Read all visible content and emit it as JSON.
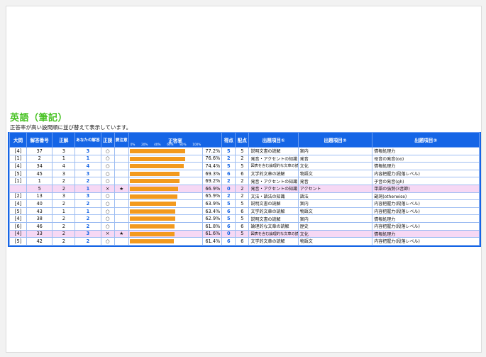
{
  "title": "英語（筆記）",
  "note": "正答率が高い設問順に並び替えて表示しています。",
  "colors": {
    "header_bg": "#1565e6",
    "bar": "#f39a1e",
    "title": "#44c11f",
    "highlight_row": "#f6d8f4"
  },
  "headers": {
    "daimon": "大問",
    "kaitou_bangou": "解答番号",
    "seikai": "正解",
    "anata": "あなたの解答",
    "seigo": "正誤",
    "chui": "要注意",
    "rate": "正答率",
    "tokuten": "得点",
    "haiten": "配点",
    "item1": "出題項目①",
    "item2": "出題項目②",
    "item3": "出題項目③"
  },
  "rate_ticks": [
    "0%",
    "20%",
    "40%",
    "60%",
    "80%",
    "100%"
  ],
  "rows": [
    {
      "daimon": "[4]",
      "num": "37",
      "correct": "3",
      "answer": "3",
      "judge": "○",
      "flag": "",
      "rate": 77.2,
      "rate_label": "77.2%",
      "score": "5",
      "points": "5",
      "item1": "説明文書の読解",
      "item2": "案内",
      "item3": "情報処理力",
      "highlight": false
    },
    {
      "daimon": "[1]",
      "num": "2",
      "correct": "1",
      "answer": "1",
      "judge": "○",
      "flag": "",
      "rate": 76.6,
      "rate_label": "76.6%",
      "score": "2",
      "points": "2",
      "item1": "発音・アクセントの知識",
      "item2": "発音",
      "item3": "母音の発音(oo)",
      "highlight": false
    },
    {
      "daimon": "[4]",
      "num": "34",
      "correct": "4",
      "answer": "4",
      "judge": "○",
      "flag": "",
      "rate": 74.4,
      "rate_label": "74.4%",
      "score": "5",
      "points": "5",
      "item1": "図表を含む論理的な文章の読解",
      "item2": "文化",
      "item3": "情報処理力",
      "highlight": false
    },
    {
      "daimon": "[5]",
      "num": "45",
      "correct": "3",
      "answer": "3",
      "judge": "○",
      "flag": "",
      "rate": 69.3,
      "rate_label": "69.3%",
      "score": "6",
      "points": "6",
      "item1": "文学的文章の読解",
      "item2": "物語文",
      "item3": "内容把握力(段落レベル)",
      "highlight": false
    },
    {
      "daimon": "[1]",
      "num": "1",
      "correct": "2",
      "answer": "2",
      "judge": "○",
      "flag": "",
      "rate": 69.2,
      "rate_label": "69.2%",
      "score": "2",
      "points": "2",
      "item1": "発音・アクセントの知識",
      "item2": "発音",
      "item3": "子音の発音(gh)",
      "highlight": false
    },
    {
      "daimon": "",
      "num": "5",
      "correct": "2",
      "answer": "1",
      "judge": "×",
      "flag": "★",
      "rate": 66.9,
      "rate_label": "66.9%",
      "score": "0",
      "points": "2",
      "item1": "発音・アクセントの知識",
      "item2": "アクセント",
      "item3": "単語の強勢(3音節)",
      "highlight": true
    },
    {
      "daimon": "[2]",
      "num": "13",
      "correct": "3",
      "answer": "3",
      "judge": "○",
      "flag": "",
      "rate": 65.9,
      "rate_label": "65.9%",
      "score": "2",
      "points": "2",
      "item1": "文法・語法の知識",
      "item2": "語法",
      "item3": "副詞(otherwise)",
      "highlight": false
    },
    {
      "daimon": "[4]",
      "num": "40",
      "correct": "2",
      "answer": "2",
      "judge": "○",
      "flag": "",
      "rate": 63.9,
      "rate_label": "63.9%",
      "score": "5",
      "points": "5",
      "item1": "説明文書の読解",
      "item2": "案内",
      "item3": "内容把握力(段落レベル)",
      "highlight": false
    },
    {
      "daimon": "[5]",
      "num": "43",
      "correct": "1",
      "answer": "1",
      "judge": "○",
      "flag": "",
      "rate": 63.4,
      "rate_label": "63.4%",
      "score": "6",
      "points": "6",
      "item1": "文学的文章の読解",
      "item2": "物語文",
      "item3": "内容把握力(段落レベル)",
      "highlight": false
    },
    {
      "daimon": "[4]",
      "num": "38",
      "correct": "2",
      "answer": "2",
      "judge": "○",
      "flag": "",
      "rate": 62.9,
      "rate_label": "62.9%",
      "score": "5",
      "points": "5",
      "item1": "説明文書の読解",
      "item2": "案内",
      "item3": "情報処理力",
      "highlight": false
    },
    {
      "daimon": "[6]",
      "num": "46",
      "correct": "2",
      "answer": "2",
      "judge": "○",
      "flag": "",
      "rate": 61.8,
      "rate_label": "61.8%",
      "score": "6",
      "points": "6",
      "item1": "論理的な文章の読解",
      "item2": "歴史",
      "item3": "内容把握力(段落レベル)",
      "highlight": false
    },
    {
      "daimon": "[4]",
      "num": "33",
      "correct": "2",
      "answer": "3",
      "judge": "×",
      "flag": "★",
      "rate": 61.6,
      "rate_label": "61.6%",
      "score": "0",
      "points": "5",
      "item1": "図表を含む論理的な文章の読解",
      "item2": "文化",
      "item3": "情報処理力",
      "highlight": true
    },
    {
      "daimon": "[5]",
      "num": "42",
      "correct": "2",
      "answer": "2",
      "judge": "○",
      "flag": "",
      "rate": 61.4,
      "rate_label": "61.4%",
      "score": "6",
      "points": "6",
      "item1": "文学的文章の読解",
      "item2": "物語文",
      "item3": "内容把握力(段落レベル)",
      "highlight": false
    }
  ]
}
